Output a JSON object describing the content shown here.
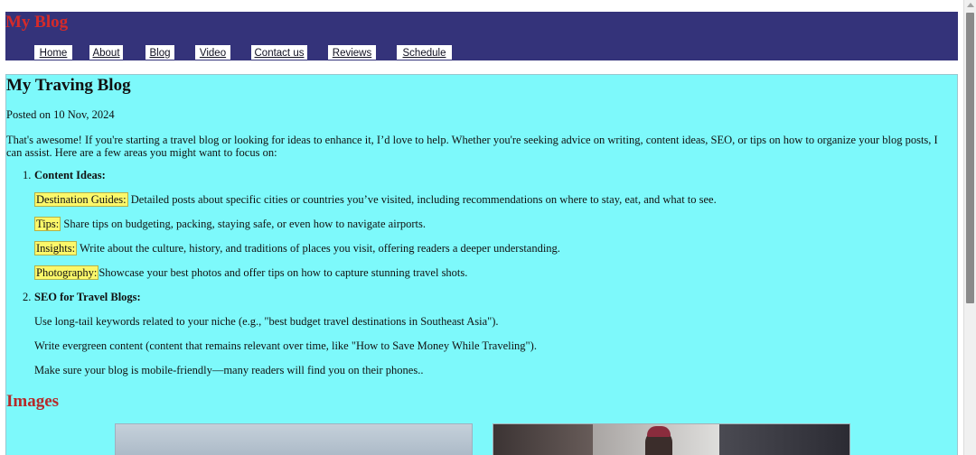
{
  "site": {
    "title": "My Blog"
  },
  "nav": {
    "items": [
      {
        "label": "Home"
      },
      {
        "label": "About"
      },
      {
        "label": "Blog"
      },
      {
        "label": "Video"
      },
      {
        "label": "Contact us"
      },
      {
        "label": "Reviews"
      },
      {
        "label": "Schedule"
      }
    ]
  },
  "post": {
    "title": "My Traving Blog",
    "posted": "Posted on 10 Nov, 2024",
    "intro": "That's awesome! If you're starting a travel blog or looking for ideas to enhance it, I’d love to help. Whether you're seeking advice on writing, content ideas, SEO, or tips on how to organize your blog posts, I can assist. Here are a few areas you might want to focus on:",
    "sections": [
      {
        "number": "1.",
        "heading": "Content Ideas:",
        "items": [
          {
            "highlight": "Destination Guides:",
            "text": " Detailed posts about specific cities or countries you’ve visited, including recommendations on where to stay, eat, and what to see."
          },
          {
            "highlight": "Tips:",
            "text": " Share tips on budgeting, packing, staying safe, or even how to navigate airports."
          },
          {
            "highlight": "Insights:",
            "text": " Write about the culture, history, and traditions of places you visit, offering readers a deeper understanding."
          },
          {
            "highlight": "Photography:",
            "text": "Showcase your best photos and offer tips on how to capture stunning travel shots."
          }
        ]
      },
      {
        "number": "2.",
        "heading": "SEO for Travel Blogs:",
        "items": [
          {
            "text": "Use long-tail keywords related to your niche (e.g., \"best budget travel destinations in Southeast Asia\")."
          },
          {
            "text": "Write evergreen content (content that remains relevant over time, like \"How to Save Money While Traveling\")."
          },
          {
            "text": "Make sure your blog is mobile-friendly—many readers will find you on their phones.."
          }
        ]
      }
    ]
  },
  "images": {
    "title": "Images"
  }
}
